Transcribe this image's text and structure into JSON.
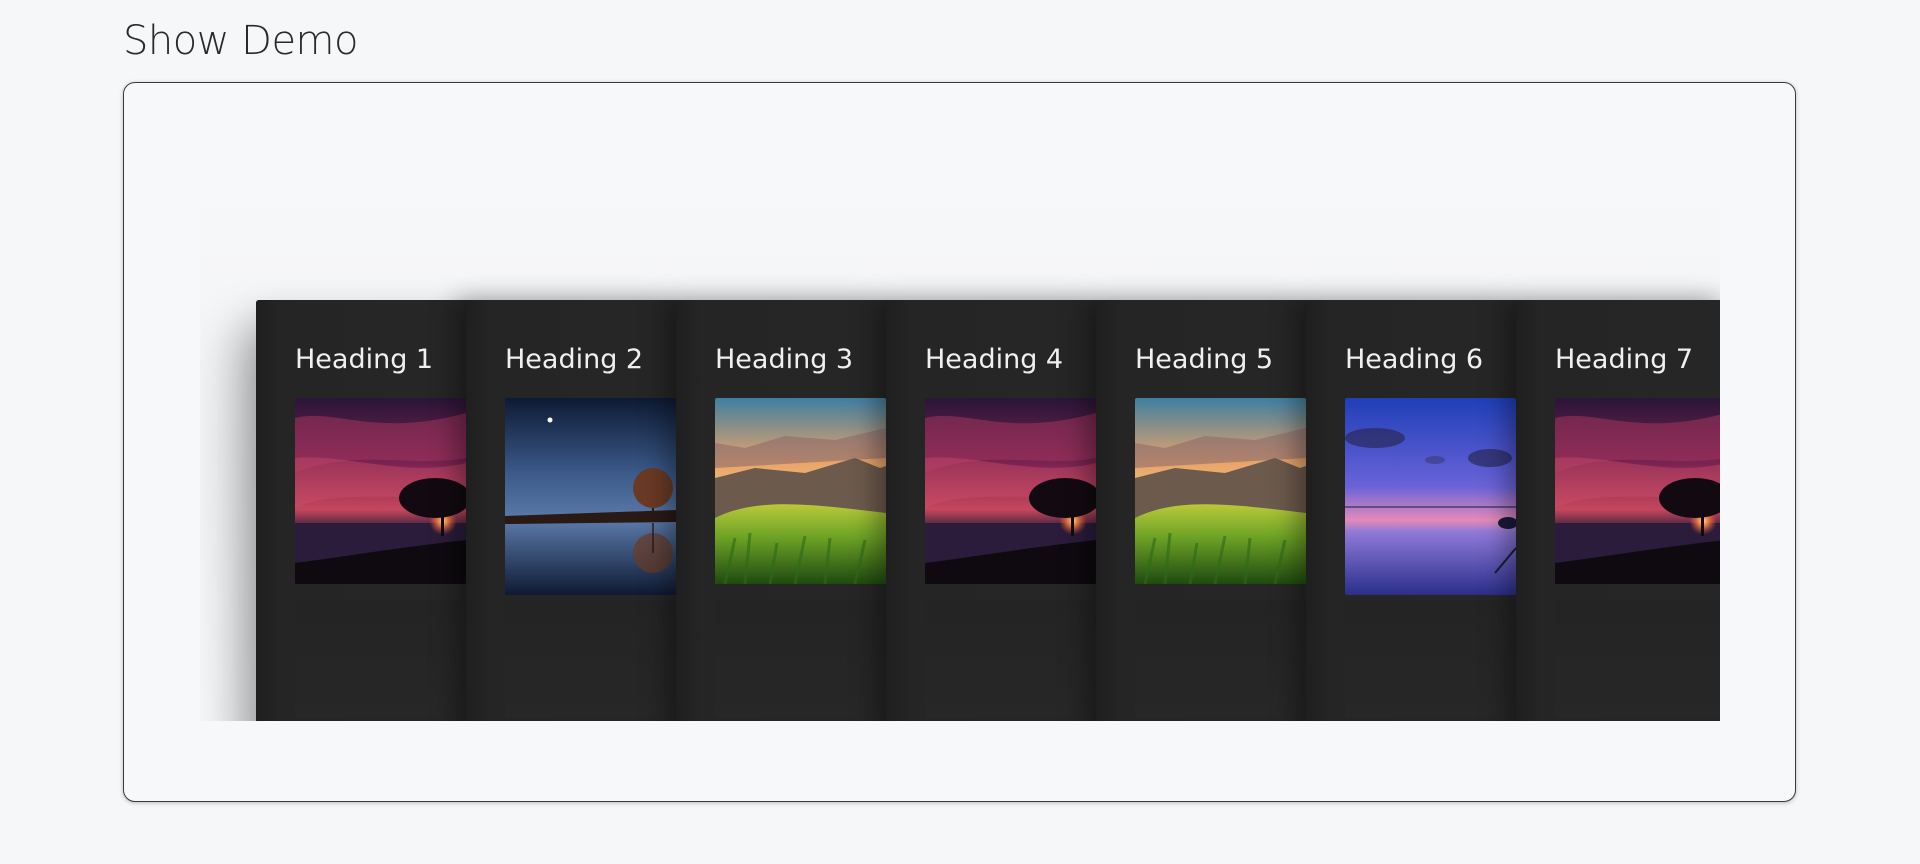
{
  "page": {
    "title": "Show Demo"
  },
  "cards": [
    {
      "heading": "Heading 1",
      "image": "sunset-tree-lake"
    },
    {
      "heading": "Heading 2",
      "image": "night-tree-reflection"
    },
    {
      "heading": "Heading 3",
      "image": "mountain-grass-meadow"
    },
    {
      "heading": "Heading 4",
      "image": "sunset-tree-lake"
    },
    {
      "heading": "Heading 5",
      "image": "mountain-grass-meadow"
    },
    {
      "heading": "Heading 6",
      "image": "twilight-lake-boat"
    },
    {
      "heading": "Heading 7",
      "image": "sunset-tree-lake"
    }
  ],
  "colors": {
    "page_background": "#f6f7f9",
    "card_background": "#222222",
    "heading_text": "#f0f0f0",
    "title_text": "#2a2a2a"
  }
}
